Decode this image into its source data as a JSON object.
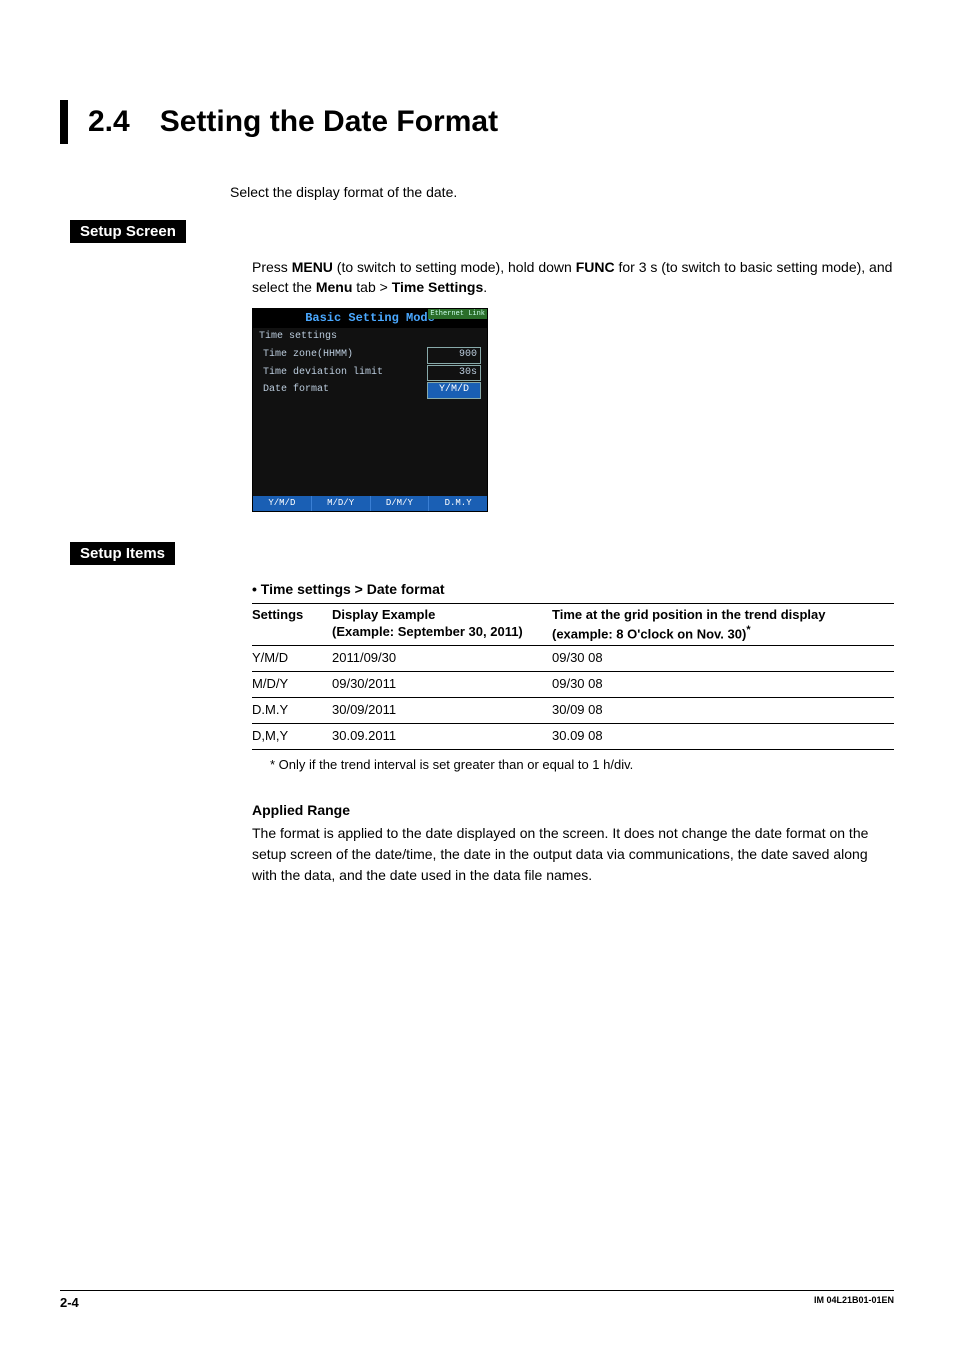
{
  "heading": {
    "number": "2.4",
    "title": "Setting the Date Format"
  },
  "intro": "Select the display format of the date.",
  "sections": {
    "setup_screen": {
      "label": "Setup Screen",
      "text_parts": {
        "p1a": "Press ",
        "p1b": "MENU",
        "p1c": " (to switch to setting mode), hold down ",
        "p1d": "FUNC",
        "p1e": " for 3 s (to switch to basic setting mode), and select the ",
        "p1f": "Menu",
        "p1g": " tab > ",
        "p1h": "Time Settings",
        "p1i": "."
      }
    },
    "setup_items": {
      "label": "Setup Items"
    }
  },
  "screenshot": {
    "title": "Basic Setting Mode",
    "tag": "Ethernet\nLink",
    "subtitle": "Time settings",
    "rows": [
      {
        "label": "Time zone(HHMM)",
        "value": "900",
        "active": false
      },
      {
        "label": "Time deviation limit",
        "value": "30s",
        "active": false
      },
      {
        "label": "Date format",
        "value": "Y/M/D",
        "active": true
      }
    ],
    "footer_options": [
      "Y/M/D",
      "M/D/Y",
      "D/M/Y",
      "D.M.Y"
    ]
  },
  "bullet_title": "•  Time settings > Date format",
  "table": {
    "headers": {
      "c1": "Settings",
      "c2a": "Display Example",
      "c2b": "(Example: September 30, 2011)",
      "c3a": "Time at the grid position in the trend display",
      "c3b": "(example: 8 O'clock on Nov. 30)"
    },
    "rows": [
      {
        "c1": "Y/M/D",
        "c2": "2011/09/30",
        "c3": "09/30 08"
      },
      {
        "c1": "M/D/Y",
        "c2": "09/30/2011",
        "c3": "09/30 08"
      },
      {
        "c1": "D.M.Y",
        "c2": "30/09/2011",
        "c3": "30/09 08"
      },
      {
        "c1": "D,M,Y",
        "c2": "30.09.2011",
        "c3": "30.09 08"
      }
    ]
  },
  "footnote": "*   Only if the trend interval is set greater than or equal to 1 h/div.",
  "applied": {
    "title": "Applied Range",
    "body": "The format is applied to the date displayed on the screen. It does not change the date format on the setup screen of the date/time, the date in the output data via communications, the date saved along with the data, and the date used in the data file names."
  },
  "footer": {
    "page": "2-4",
    "doc": "IM 04L21B01-01EN"
  }
}
